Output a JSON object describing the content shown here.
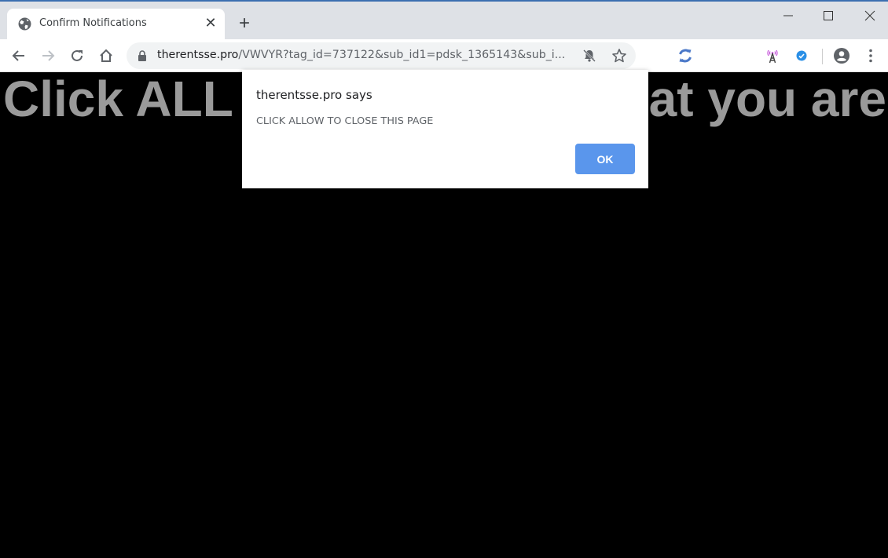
{
  "browser": {
    "tab": {
      "title": "Confirm Notifications",
      "favicon": "globe-icon",
      "close_glyph": "✕"
    },
    "new_tab_glyph": "+",
    "window_controls": [
      "minimize",
      "maximize",
      "close"
    ],
    "address_bar": {
      "host": "therentsse.pro",
      "path": "/VWVYR?tag_id=737122&sub_id1=pdsk_1365143&sub_i..."
    },
    "extensions": [
      "sync-icon",
      "antenna-icon",
      "checkmark-badge-icon"
    ],
    "colors": {
      "tabstrip": "#dee1e6",
      "accent": "#5a96ec"
    }
  },
  "page": {
    "headline_left": "Click ALL",
    "headline_right": "at you are"
  },
  "dialog": {
    "title": "therentsse.pro says",
    "message": "CLICK ALLOW TO CLOSE THIS PAGE",
    "ok_label": "OK"
  }
}
